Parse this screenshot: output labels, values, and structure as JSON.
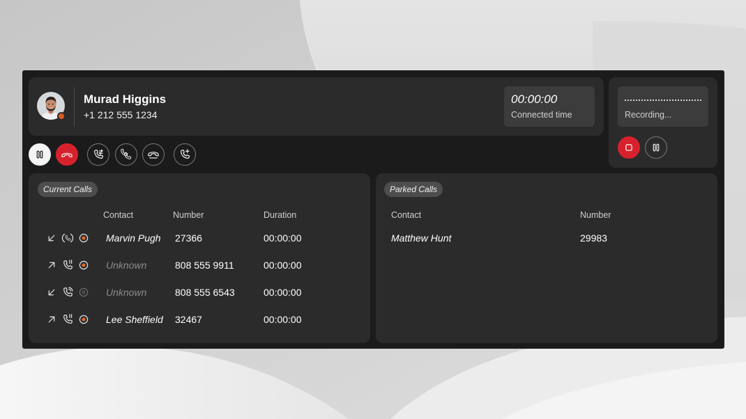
{
  "colors": {
    "panel": "#1b1b1b",
    "card": "#2b2b2b",
    "box": "#3c3c3c",
    "accent_red": "#d7222d",
    "recording_orange": "#e8692a",
    "presence": "#e05a1f",
    "muted_text": "#8c8c8c"
  },
  "caller": {
    "name": "Murad Higgins",
    "number": "+1 212 555 1234",
    "avatar_icon": "avatar-photo-icon"
  },
  "timer": {
    "value": "00:00:00",
    "label": "Connected time"
  },
  "recording": {
    "label": "Recording...",
    "controls": [
      {
        "icon": "stop-icon"
      },
      {
        "icon": "pause-icon"
      }
    ]
  },
  "call_controls": [
    {
      "icon": "pause-icon"
    },
    {
      "icon": "hangup-icon"
    },
    {
      "icon": "transfer-call-icon"
    },
    {
      "icon": "merge-call-icon"
    },
    {
      "icon": "park-call-icon"
    },
    {
      "icon": "add-call-icon"
    }
  ],
  "current_calls": {
    "chip": "Current Calls",
    "headers": {
      "contact": "Contact",
      "number": "Number",
      "duration": "Duration"
    },
    "rows": [
      {
        "direction_icon": "incoming-arrow-icon",
        "status_icon": "call-active-icon",
        "recording": true,
        "contact": "Marvin Pugh",
        "contact_known": true,
        "number": "27366",
        "duration": "00:00:00"
      },
      {
        "direction_icon": "outgoing-arrow-icon",
        "status_icon": "call-held-icon",
        "recording": true,
        "contact": "Unknown",
        "contact_known": false,
        "number": "808 555 9911",
        "duration": "00:00:00"
      },
      {
        "direction_icon": "incoming-arrow-icon",
        "status_icon": "call-ringing-icon",
        "recording": false,
        "contact": "Unknown",
        "contact_known": false,
        "number": "808 555 6543",
        "duration": "00:00:00"
      },
      {
        "direction_icon": "outgoing-arrow-icon",
        "status_icon": "call-held-icon",
        "recording": true,
        "contact": "Lee Sheffield",
        "contact_known": true,
        "number": "32467",
        "duration": "00:00:00"
      }
    ]
  },
  "parked_calls": {
    "chip": "Parked Calls",
    "headers": {
      "contact": "Contact",
      "number": "Number"
    },
    "rows": [
      {
        "contact": "Matthew Hunt",
        "number": "29983"
      }
    ]
  }
}
